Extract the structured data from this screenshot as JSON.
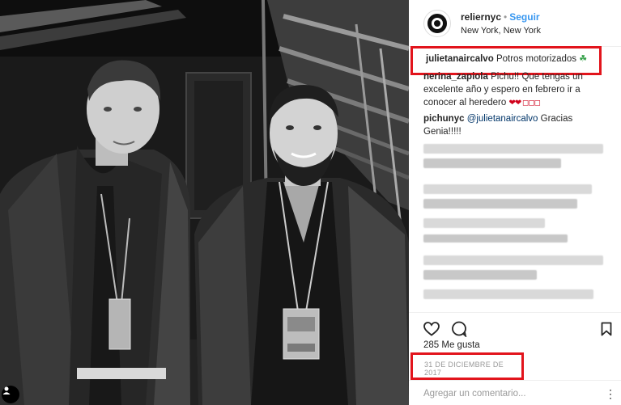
{
  "post": {
    "account_name": "reliernyc",
    "separator": "•",
    "follow_label": "Seguir",
    "location": "New York, New York"
  },
  "comments": [
    {
      "user": "julietanaircalvo",
      "text": "Potros motorizados",
      "emoji": "☘"
    },
    {
      "user": "nerina_zapiola",
      "text": "Pichu!! Que tengas un excelente año y espero en febrero ir a conocer al heredero",
      "emoji": "❤❤ ◻◻◻"
    },
    {
      "user": "pichunyc",
      "mention": "@julietanaircalvo",
      "text": "Gracias Genia!!!!!"
    }
  ],
  "stats": {
    "likes": "285 Me gusta",
    "date": "31 DE DICIEMBRE DE 2017"
  },
  "comment_box": {
    "placeholder": "Agregar un comentario..."
  },
  "icons": {
    "like": "heart-outline-icon",
    "comment": "speech-bubble-icon",
    "save": "bookmark-icon",
    "more": "more-options-icon",
    "user": "user-tag-icon"
  },
  "colors": {
    "highlight": "#e2141c",
    "follow": "#3897f0"
  }
}
